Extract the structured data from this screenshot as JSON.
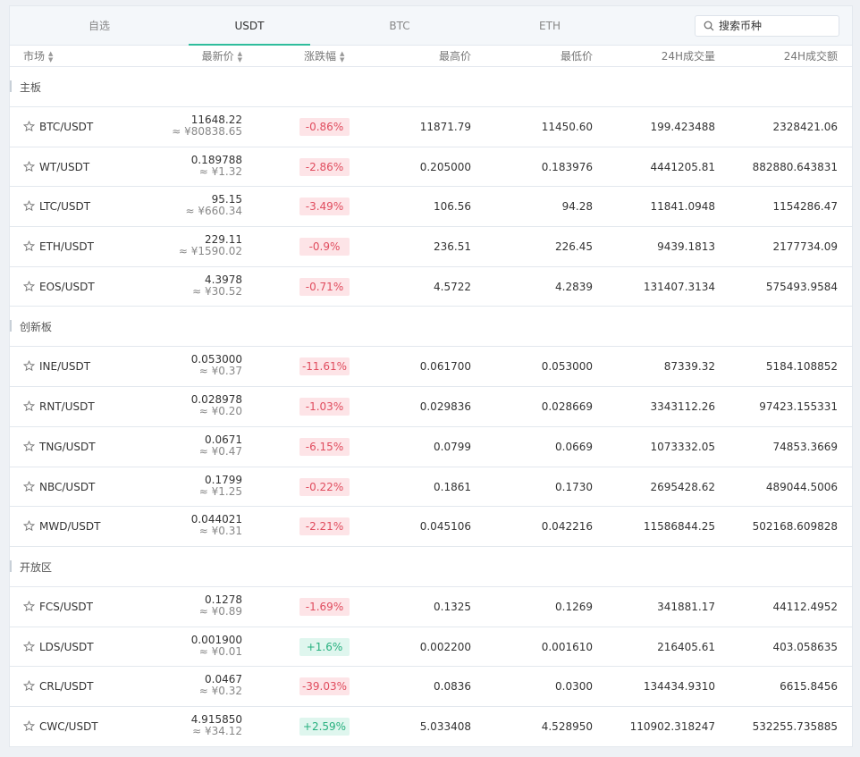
{
  "tabs": [
    "自选",
    "USDT",
    "BTC",
    "ETH"
  ],
  "active_tab": 1,
  "search": {
    "placeholder": "搜索币种"
  },
  "columns": {
    "market": "市场",
    "last_price": "最新价",
    "change": "涨跌幅",
    "high": "最高价",
    "low": "最低价",
    "volume_24h": "24H成交量",
    "amount_24h": "24H成交额"
  },
  "colors": {
    "accent": "#2ebd9c",
    "down": "#e04c5e",
    "down_bg": "#fde4e7",
    "up": "#26b07e",
    "up_bg": "#dff6ee"
  },
  "sections": [
    {
      "title": "主板",
      "rows": [
        {
          "pair": "BTC/USDT",
          "price": "11648.22",
          "cny": "≈ ¥80838.65",
          "change": "-0.86%",
          "dir": "down",
          "high": "11871.79",
          "low": "11450.60",
          "volume": "199.423488",
          "amount": "2328421.06"
        },
        {
          "pair": "WT/USDT",
          "price": "0.189788",
          "cny": "≈ ¥1.32",
          "change": "-2.86%",
          "dir": "down",
          "high": "0.205000",
          "low": "0.183976",
          "volume": "4441205.81",
          "amount": "882880.643831"
        },
        {
          "pair": "LTC/USDT",
          "price": "95.15",
          "cny": "≈ ¥660.34",
          "change": "-3.49%",
          "dir": "down",
          "high": "106.56",
          "low": "94.28",
          "volume": "11841.0948",
          "amount": "1154286.47"
        },
        {
          "pair": "ETH/USDT",
          "price": "229.11",
          "cny": "≈ ¥1590.02",
          "change": "-0.9%",
          "dir": "down",
          "high": "236.51",
          "low": "226.45",
          "volume": "9439.1813",
          "amount": "2177734.09"
        },
        {
          "pair": "EOS/USDT",
          "price": "4.3978",
          "cny": "≈ ¥30.52",
          "change": "-0.71%",
          "dir": "down",
          "high": "4.5722",
          "low": "4.2839",
          "volume": "131407.3134",
          "amount": "575493.9584"
        }
      ]
    },
    {
      "title": "创新板",
      "rows": [
        {
          "pair": "INE/USDT",
          "price": "0.053000",
          "cny": "≈ ¥0.37",
          "change": "-11.61%",
          "dir": "down",
          "high": "0.061700",
          "low": "0.053000",
          "volume": "87339.32",
          "amount": "5184.108852"
        },
        {
          "pair": "RNT/USDT",
          "price": "0.028978",
          "cny": "≈ ¥0.20",
          "change": "-1.03%",
          "dir": "down",
          "high": "0.029836",
          "low": "0.028669",
          "volume": "3343112.26",
          "amount": "97423.155331"
        },
        {
          "pair": "TNG/USDT",
          "price": "0.0671",
          "cny": "≈ ¥0.47",
          "change": "-6.15%",
          "dir": "down",
          "high": "0.0799",
          "low": "0.0669",
          "volume": "1073332.05",
          "amount": "74853.3669"
        },
        {
          "pair": "NBC/USDT",
          "price": "0.1799",
          "cny": "≈ ¥1.25",
          "change": "-0.22%",
          "dir": "down",
          "high": "0.1861",
          "low": "0.1730",
          "volume": "2695428.62",
          "amount": "489044.5006"
        },
        {
          "pair": "MWD/USDT",
          "price": "0.044021",
          "cny": "≈ ¥0.31",
          "change": "-2.21%",
          "dir": "down",
          "high": "0.045106",
          "low": "0.042216",
          "volume": "11586844.25",
          "amount": "502168.609828"
        }
      ]
    },
    {
      "title": "开放区",
      "rows": [
        {
          "pair": "FCS/USDT",
          "price": "0.1278",
          "cny": "≈ ¥0.89",
          "change": "-1.69%",
          "dir": "down",
          "high": "0.1325",
          "low": "0.1269",
          "volume": "341881.17",
          "amount": "44112.4952"
        },
        {
          "pair": "LDS/USDT",
          "price": "0.001900",
          "cny": "≈ ¥0.01",
          "change": "+1.6%",
          "dir": "up",
          "high": "0.002200",
          "low": "0.001610",
          "volume": "216405.61",
          "amount": "403.058635"
        },
        {
          "pair": "CRL/USDT",
          "price": "0.0467",
          "cny": "≈ ¥0.32",
          "change": "-39.03%",
          "dir": "down",
          "high": "0.0836",
          "low": "0.0300",
          "volume": "134434.9310",
          "amount": "6615.8456"
        },
        {
          "pair": "CWC/USDT",
          "price": "4.915850",
          "cny": "≈ ¥34.12",
          "change": "+2.59%",
          "dir": "up",
          "high": "5.033408",
          "low": "4.528950",
          "volume": "110902.318247",
          "amount": "532255.735885"
        }
      ]
    }
  ]
}
